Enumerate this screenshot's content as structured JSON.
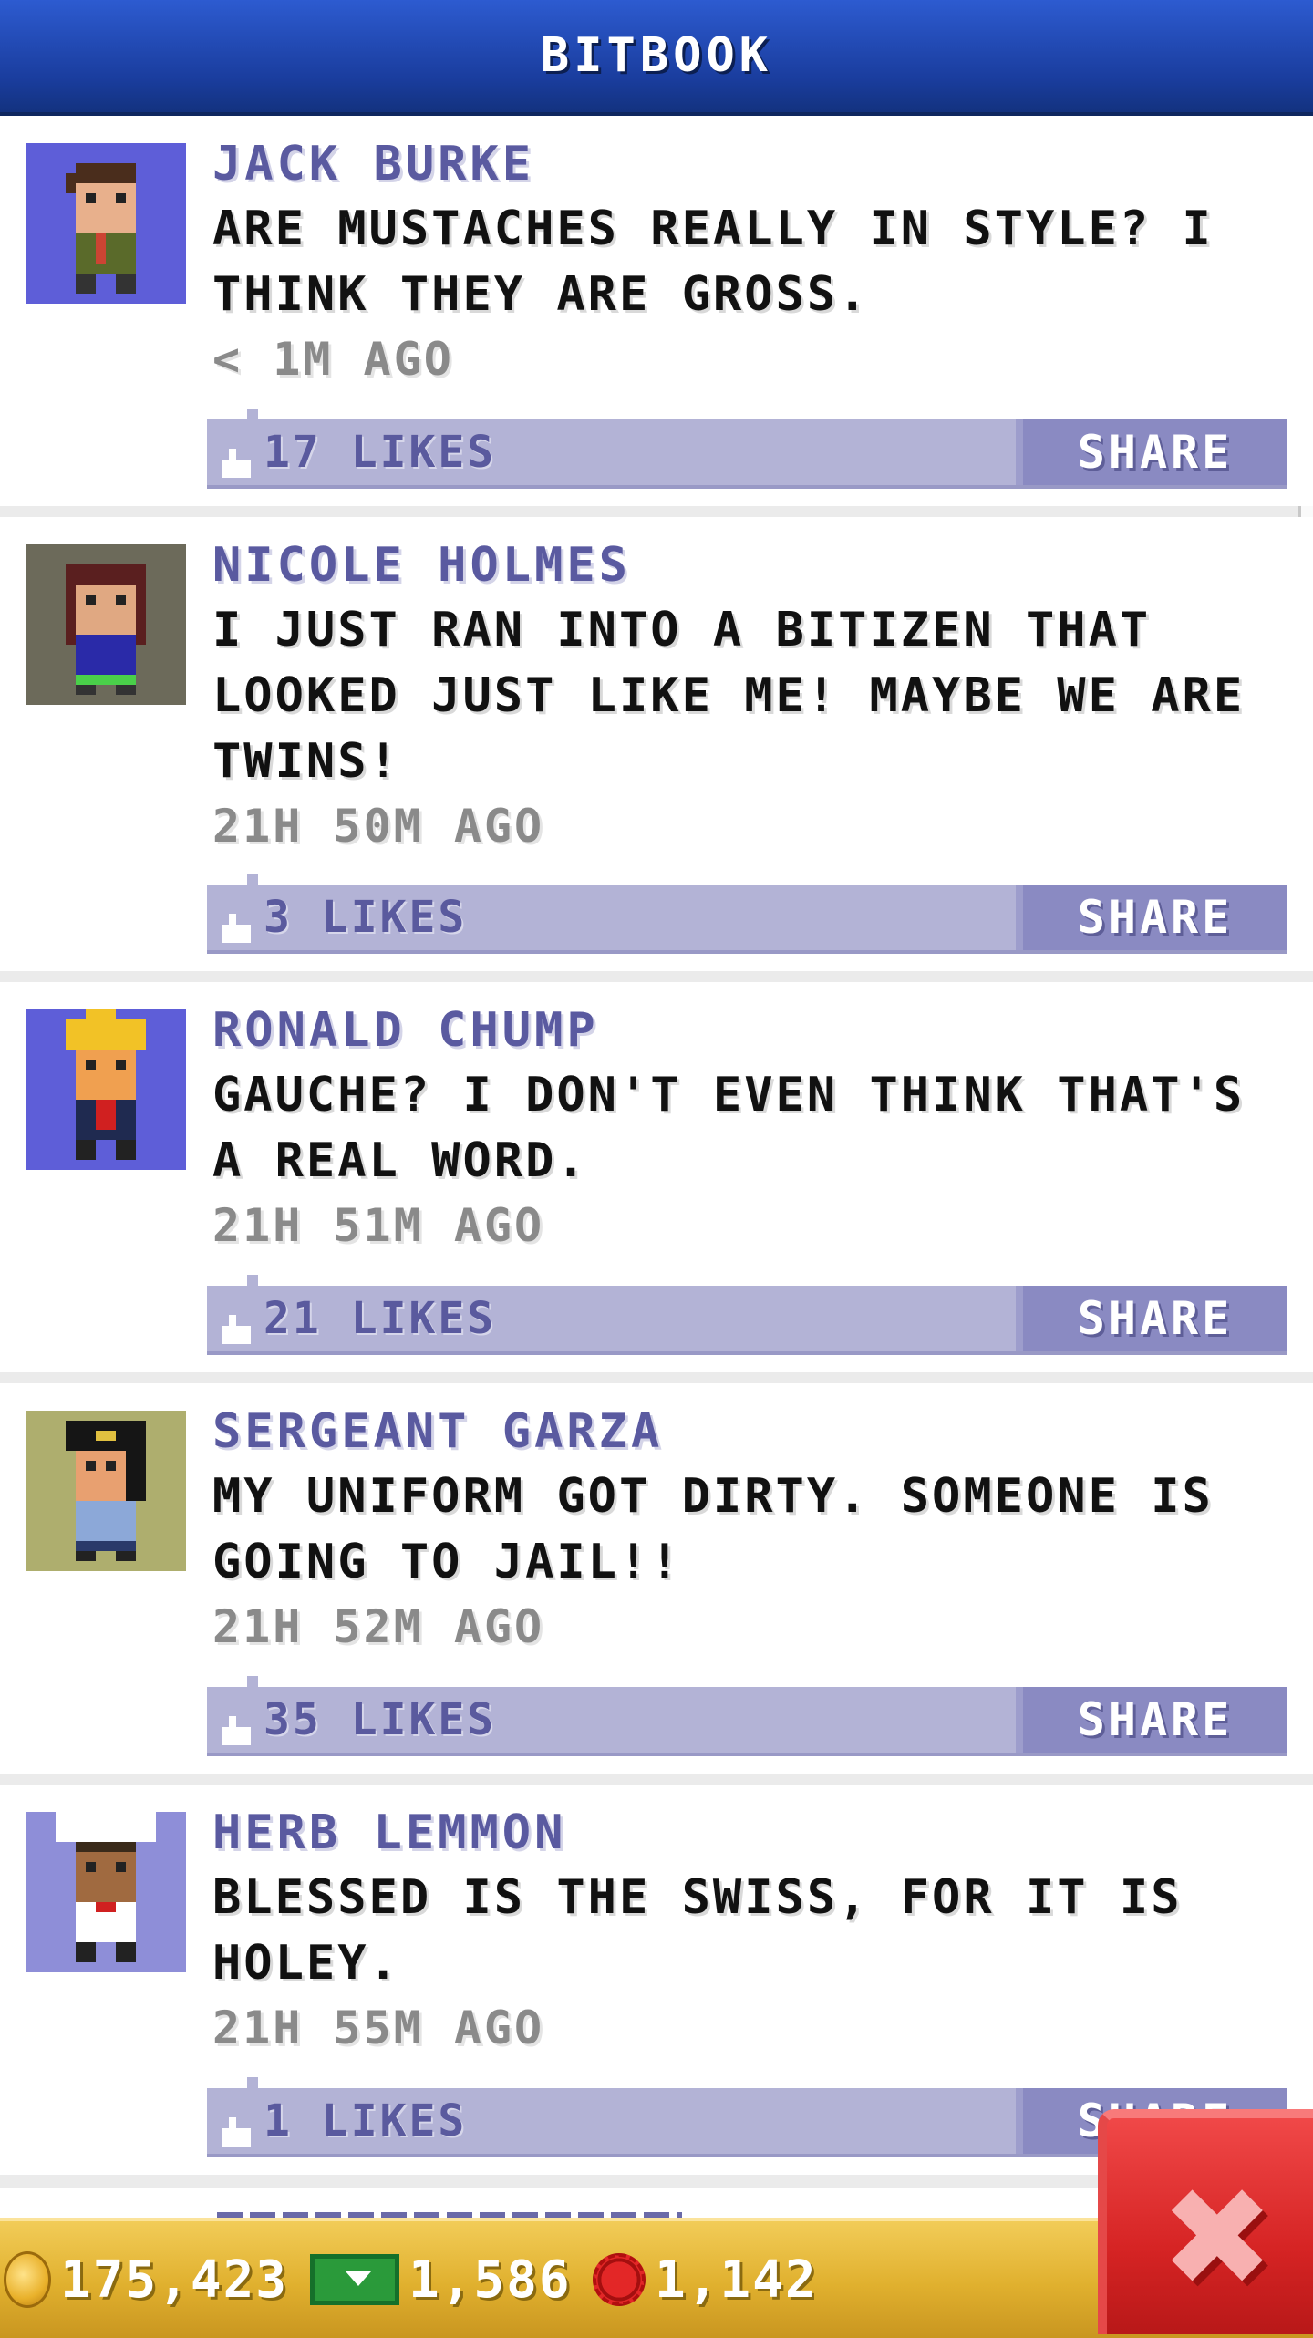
{
  "header": {
    "title": "BITBOOK"
  },
  "posts": [
    {
      "name": "JACK BURKE",
      "message": "ARE MUSTACHES REALLY IN STYLE? I THINK THEY ARE GROSS.",
      "time": "< 1M AGO",
      "likes": "17 LIKES",
      "share": "SHARE",
      "avatar_bg": "#5e5ed8"
    },
    {
      "name": "NICOLE HOLMES",
      "message": "I JUST RAN INTO A BITIZEN THAT LOOKED JUST LIKE ME! MAYBE WE ARE TWINS!",
      "time": "21H 50M AGO",
      "likes": "3 LIKES",
      "share": "SHARE",
      "avatar_bg": "#6c6a5a"
    },
    {
      "name": "RONALD CHUMP",
      "message": "GAUCHE? I DON'T EVEN THINK THAT'S A REAL WORD.",
      "time": "21H 51M AGO",
      "likes": "21 LIKES",
      "share": "SHARE",
      "avatar_bg": "#5e5ed8"
    },
    {
      "name": "SERGEANT GARZA",
      "message": "MY UNIFORM GOT DIRTY. SOMEONE IS GOING TO JAIL!!",
      "time": "21H 52M AGO",
      "likes": "35 LIKES",
      "share": "SHARE",
      "avatar_bg": "#aeae6e"
    },
    {
      "name": "HERB LEMMON",
      "message": "BLESSED IS THE SWISS, FOR IT IS HOLEY.",
      "time": "21H 55M AGO",
      "likes": "1 LIKES",
      "share": "SHARE",
      "avatar_bg": "#8e8ed8"
    }
  ],
  "currency": {
    "coins": "175,423",
    "bux": "1,586",
    "points": "1,142"
  },
  "close_button": {
    "icon": "close-icon",
    "color": "#d62424"
  },
  "colors": {
    "header": "#1a3d9e",
    "name": "#5a5aa0",
    "likes_bar": "#b3b3d6",
    "share_button": "#8a8ac2",
    "bottom_bar": "#e0b02e"
  }
}
